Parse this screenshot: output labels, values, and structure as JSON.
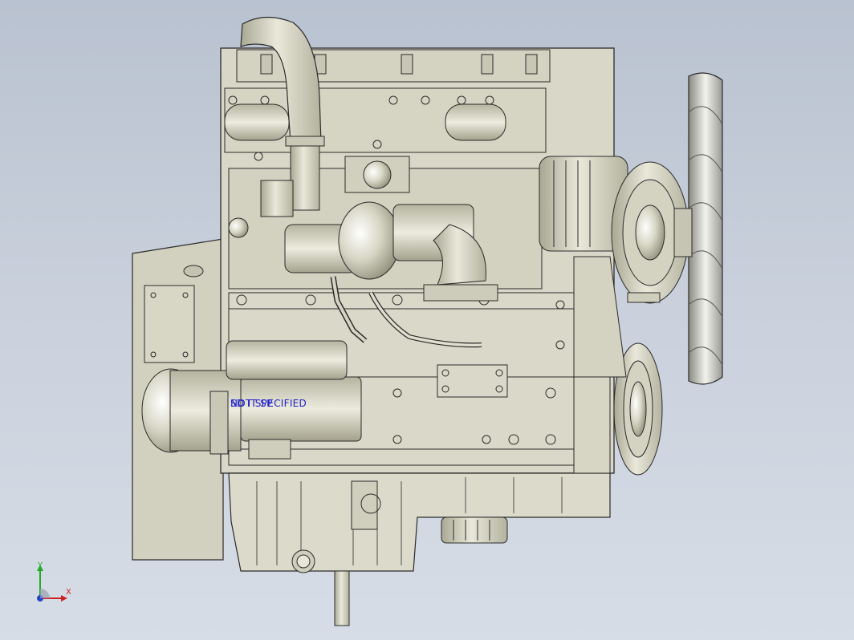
{
  "viewport": {
    "background_top": "#b9c2d0",
    "background_bottom": "#d7dde6",
    "model_color": "#d9d8c8",
    "outline_color": "#2a2a2a"
  },
  "annotations": {
    "note_1": "SD IT SP",
    "note_2": "NOT SPECIFIED"
  },
  "triad": {
    "x_label": "X",
    "y_label": "Y",
    "x_color": "#cc2222",
    "y_color": "#22aa22",
    "z_color": "#2244cc"
  }
}
